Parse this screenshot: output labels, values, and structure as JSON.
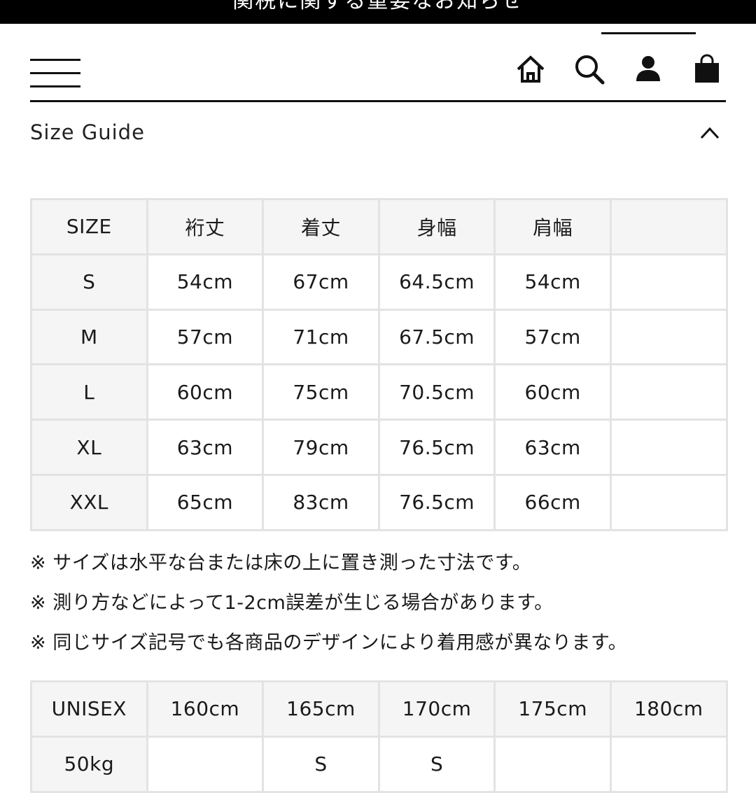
{
  "announcement": {
    "text": "関税に関する重要なお知らせ"
  },
  "header": {
    "icons": {
      "menu": "hamburger-menu-icon",
      "home": "home-icon",
      "search": "search-icon",
      "account": "user-icon",
      "cart": "shopping-bag-icon"
    }
  },
  "size_guide": {
    "title": "Size Guide",
    "toggle_icon": "chevron-up-icon",
    "size_table": {
      "headers": [
        "SIZE",
        "裄丈",
        "着丈",
        "身幅",
        "肩幅",
        ""
      ],
      "rows": [
        [
          "S",
          "54cm",
          "67cm",
          "64.5cm",
          "54cm",
          ""
        ],
        [
          "M",
          "57cm",
          "71cm",
          "67.5cm",
          "57cm",
          ""
        ],
        [
          "L",
          "60cm",
          "75cm",
          "70.5cm",
          "60cm",
          ""
        ],
        [
          "XL",
          "63cm",
          "79cm",
          "76.5cm",
          "63cm",
          ""
        ],
        [
          "XXL",
          "65cm",
          "83cm",
          "76.5cm",
          "66cm",
          ""
        ]
      ]
    },
    "notes": [
      "※ サイズは水平な台または床の上に置き測った寸法です。",
      "※ 測り方などによって1-2cm誤差が生じる場合があります。",
      "※ 同じサイズ記号でも各商品のデザインにより着用感が異なります。"
    ],
    "height_table": {
      "headers": [
        "UNISEX",
        "160cm",
        "165cm",
        "170cm",
        "175cm",
        "180cm"
      ],
      "rows": [
        [
          "50kg",
          "",
          "S",
          "S",
          "",
          ""
        ]
      ]
    }
  },
  "colors": {
    "background": "#ffffff",
    "announcement_bar": "#000000",
    "text": "#111111",
    "table_border": "#e3e3e3",
    "table_header_bg": "#f5f5f5"
  }
}
